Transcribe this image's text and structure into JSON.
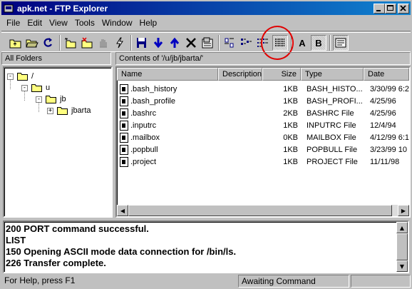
{
  "window": {
    "title": "apk.net - FTP Explorer"
  },
  "menu": [
    "File",
    "Edit",
    "View",
    "Tools",
    "Window",
    "Help"
  ],
  "toolbar": {
    "bold_a": "A",
    "bold_b": "B"
  },
  "panes": {
    "folders_header": "All Folders",
    "contents_header": "Contents of '/u/jb/jbarta/'"
  },
  "tree": [
    {
      "label": "/",
      "expander": "-"
    },
    {
      "label": "u",
      "expander": "-"
    },
    {
      "label": "jb",
      "expander": "-"
    },
    {
      "label": "jbarta",
      "expander": "+"
    }
  ],
  "columns": [
    "Name",
    "Description",
    "Size",
    "Type",
    "Date"
  ],
  "files": [
    {
      "name": ".bash_history",
      "size": "1KB",
      "type": "BASH_HISTO...",
      "date": "3/30/99 6:2"
    },
    {
      "name": ".bash_profile",
      "size": "1KB",
      "type": "BASH_PROFI...",
      "date": "4/25/96"
    },
    {
      "name": ".bashrc",
      "size": "2KB",
      "type": "BASHRC File",
      "date": "4/25/96"
    },
    {
      "name": ".inputrc",
      "size": "1KB",
      "type": "INPUTRC File",
      "date": "12/4/94"
    },
    {
      "name": ".mailbox",
      "size": "0KB",
      "type": "MAILBOX File",
      "date": "4/12/99 6:1"
    },
    {
      "name": ".popbull",
      "size": "1KB",
      "type": "POPBULL File",
      "date": "3/23/99 10"
    },
    {
      "name": ".project",
      "size": "1KB",
      "type": "PROJECT File",
      "date": "11/11/98"
    }
  ],
  "log": [
    "200 PORT command successful.",
    "LIST",
    "150 Opening ASCII mode data connection for /bin/ls.",
    "226 Transfer complete."
  ],
  "status": {
    "help": "For Help, press F1",
    "state": "Awaiting Command"
  },
  "colors": {
    "title_start": "#000080",
    "title_end": "#1084d0",
    "highlight": "#e00000",
    "face": "#c0c0c0"
  }
}
